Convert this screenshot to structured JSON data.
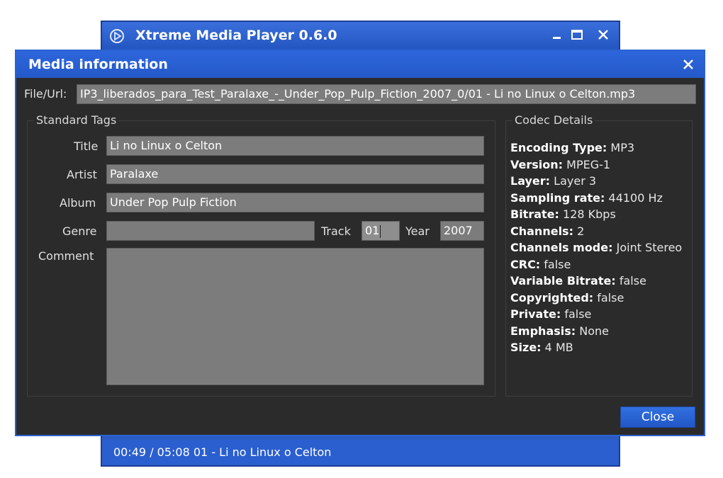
{
  "main_window": {
    "title": "Xtreme Media Player 0.6.0",
    "status": "00:49 / 05:08  01 - Li no Linux o Celton"
  },
  "dialog": {
    "title": "Media information",
    "file_label": "File/Url:",
    "file_value": "IP3_liberados_para_Test_Paralaxe_-_Under_Pop_Pulp_Fiction_2007_0/01 - Li no Linux o Celton.mp3",
    "standard_tags": {
      "group_title": "Standard Tags",
      "title_label": "Title",
      "title_value": "Li no Linux o Celton",
      "artist_label": "Artist",
      "artist_value": "Paralaxe",
      "album_label": "Album",
      "album_value": "Under Pop Pulp Fiction",
      "genre_label": "Genre",
      "genre_value": "",
      "track_label": "Track",
      "track_value": "01",
      "year_label": "Year",
      "year_value": "2007",
      "comment_label": "Comment",
      "comment_value": ""
    },
    "codec": {
      "group_title": "Codec Details",
      "encoding_type_label": "Encoding Type:",
      "encoding_type_value": "MP3",
      "version_label": "Version:",
      "version_value": "MPEG-1",
      "layer_label": "Layer:",
      "layer_value": "Layer 3",
      "sampling_rate_label": "Sampling rate:",
      "sampling_rate_value": "44100 Hz",
      "bitrate_label": "Bitrate:",
      "bitrate_value": "128 Kbps",
      "channels_label": "Channels:",
      "channels_value": "2",
      "channels_mode_label": "Channels mode:",
      "channels_mode_value": "Joint Stereo",
      "crc_label": "CRC:",
      "crc_value": "false",
      "vbr_label": "Variable Bitrate:",
      "vbr_value": "false",
      "copyrighted_label": "Copyrighted:",
      "copyrighted_value": "false",
      "private_label": "Private:",
      "private_value": "false",
      "emphasis_label": "Emphasis:",
      "emphasis_value": "None",
      "size_label": "Size:",
      "size_value": "4 MB"
    },
    "close_button_label": "Close"
  },
  "colors": {
    "titlebar_blue": "#2459c8",
    "dialog_bg": "#2b2b2b",
    "field_bg": "#7c7c7c"
  },
  "icons": {
    "player_logo": "play-circle-icon",
    "minimize": "minimize-icon",
    "maximize": "maximize-icon",
    "close": "close-icon"
  }
}
